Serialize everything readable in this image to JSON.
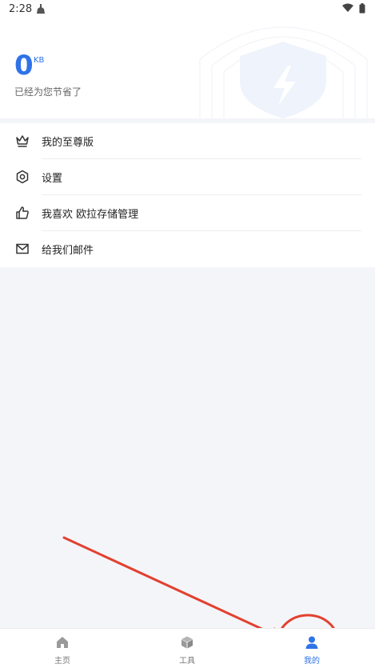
{
  "status_bar": {
    "time": "2:28",
    "icons": [
      "cleaner-icon",
      "wifi-icon",
      "battery-icon"
    ]
  },
  "header": {
    "saved_value": "0",
    "saved_unit": "KB",
    "saved_label": "已经为您节省了"
  },
  "menu": {
    "items": [
      {
        "label": "我的至尊版",
        "icon": "crown-icon"
      },
      {
        "label": "设置",
        "icon": "settings-icon"
      },
      {
        "label": "我喜欢 欧拉存储管理",
        "icon": "thumbs-up-icon"
      },
      {
        "label": "给我们邮件",
        "icon": "mail-icon"
      }
    ]
  },
  "bottom_nav": {
    "items": [
      {
        "label": "主页",
        "icon": "home-icon",
        "active": false
      },
      {
        "label": "工具",
        "icon": "box-icon",
        "active": false
      },
      {
        "label": "我的",
        "icon": "person-icon",
        "active": true
      }
    ]
  },
  "colors": {
    "accent": "#2f73e8",
    "annotation": "#e2412f",
    "background": "#f4f5f9"
  }
}
